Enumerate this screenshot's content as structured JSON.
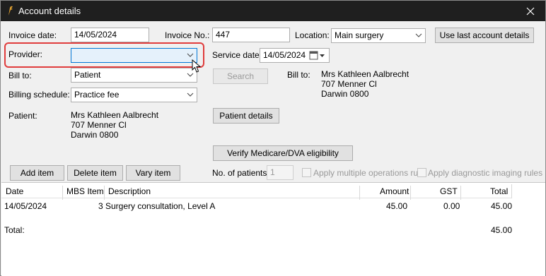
{
  "window": {
    "title": "Account details"
  },
  "form": {
    "invoice_date_label": "Invoice date:",
    "invoice_date_value": "14/05/2024",
    "invoice_no_label": "Invoice No.:",
    "invoice_no_value": "447",
    "location_label": "Location:",
    "location_value": "Main surgery",
    "use_last_button": "Use last account details",
    "provider_label": "Provider:",
    "provider_value": "",
    "service_date_label": "Service date:",
    "service_date_value": "14/05/2024",
    "bill_to_label": "Bill to:",
    "bill_to_value": "Patient",
    "search_button": "Search",
    "bill_to_right_label": "Bill to:",
    "bill_to_address": [
      "Mrs Kathleen Aalbrecht",
      "707 Menner Cl",
      "Darwin 0800"
    ],
    "billing_schedule_label": "Billing schedule:",
    "billing_schedule_value": "Practice fee",
    "patient_label": "Patient:",
    "patient_address": [
      "Mrs Kathleen Aalbrecht",
      "707 Menner Cl",
      "Darwin  0800"
    ],
    "patient_details_button": "Patient details",
    "verify_button": "Verify Medicare/DVA eligibility",
    "add_item_button": "Add item",
    "delete_item_button": "Delete item",
    "vary_item_button": "Vary item",
    "no_of_patients_label": "No. of patients:",
    "no_of_patients_value": "1",
    "apply_multiple_ops_label": "Apply multiple operations rule",
    "apply_diag_imaging_label": "Apply diagnostic imaging rules"
  },
  "table": {
    "columns": [
      "Date",
      "MBS Item",
      "Description",
      "Amount",
      "GST",
      "Total"
    ],
    "rows": [
      {
        "date": "14/05/2024",
        "mbs_item": "3",
        "description": "Surgery consultation, Level A",
        "amount": "45.00",
        "gst": "0.00",
        "total": "45.00"
      }
    ],
    "total_label": "Total:",
    "total_value": "45.00"
  },
  "colors": {
    "titlebar": "#1f1f1f",
    "highlight": "#e03c3c",
    "panel": "#f0f0f0"
  },
  "icons": [
    "app-icon",
    "close-icon",
    "chevron-down-icon",
    "calendar-icon",
    "mouse-cursor-icon"
  ]
}
